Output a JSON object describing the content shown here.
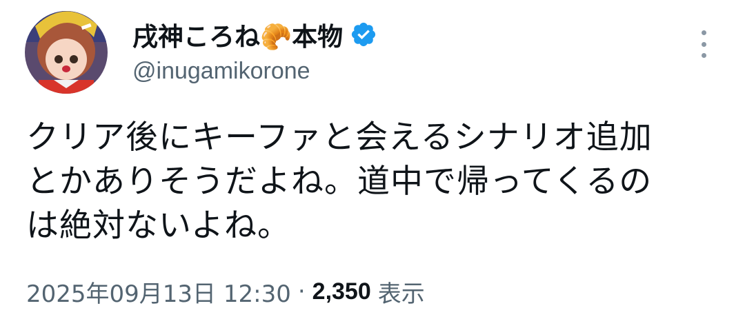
{
  "author": {
    "display_name": "戌神ころね🥐本物",
    "handle": "@inugamikorone",
    "avatar_icon": "avatar-image",
    "verified_icon": "verified-badge-icon",
    "verified_color": "#1d9bf0"
  },
  "tweet": {
    "text": "クリア後にキーファと会えるシナリオ追加\nとかありそうだよね。道中で帰ってくるの\nは絶対ないよね。"
  },
  "meta": {
    "timestamp": "2025年09月13日 12:30",
    "separator": "·",
    "views_count": "2,350",
    "views_label": "表示"
  },
  "actions": {
    "more_icon": "more-vertical-icon"
  }
}
